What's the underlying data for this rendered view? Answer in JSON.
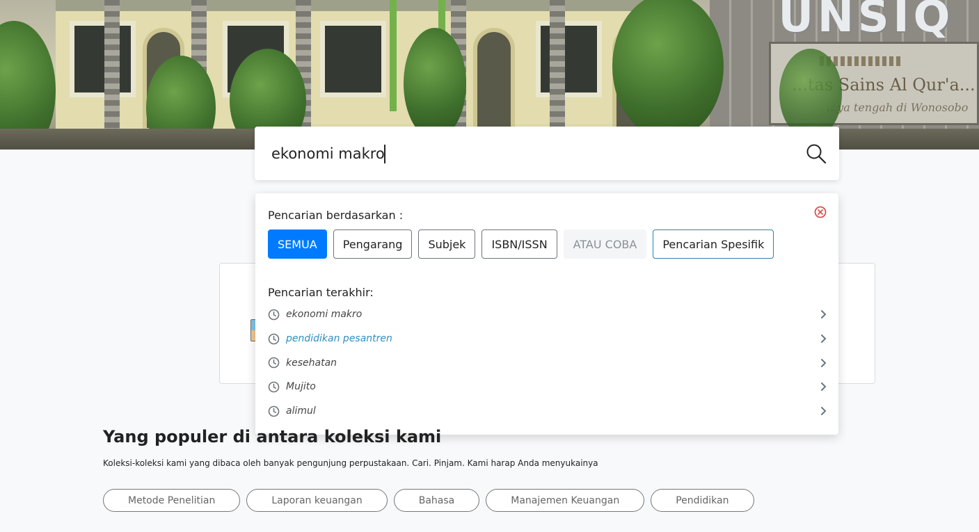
{
  "search": {
    "value": "ekonomi makro",
    "search_icon": "search-icon"
  },
  "dropdown": {
    "filter_label": "Pencarian berdasarkan :",
    "close_icon": "close-circle-icon",
    "filters": [
      {
        "label": "SEMUA",
        "state": "active"
      },
      {
        "label": "Pengarang",
        "state": "default"
      },
      {
        "label": "Subjek",
        "state": "default"
      },
      {
        "label": "ISBN/ISSN",
        "state": "default"
      },
      {
        "label": "ATAU COBA",
        "state": "muted"
      },
      {
        "label": "Pencarian Spesifik",
        "state": "outline-primary"
      }
    ],
    "recent_label": "Pencarian terakhir:",
    "recent": [
      {
        "text": "ekonomi makro",
        "highlight": false
      },
      {
        "text": "pendidikan pesantren",
        "highlight": true
      },
      {
        "text": "kesehatan",
        "highlight": false
      },
      {
        "text": "Mujito",
        "highlight": false
      },
      {
        "text": "alimul",
        "highlight": false
      }
    ]
  },
  "hero": {
    "sign_text": "UNSIQ",
    "plaque_text": "...tas Sains Al Qur'a...",
    "plaque_sub": "...ya tengah di Wonosobo"
  },
  "popular": {
    "title": "Yang populer di antara koleksi kami",
    "subtitle": "Koleksi-koleksi kami yang dibaca oleh banyak pengunjung perpustakaan. Cari. Pinjam. Kami harap Anda menyukainya",
    "tags": [
      "Metode Penelitian",
      "Laporan keuangan",
      "Bahasa",
      "Manajemen Keuangan",
      "Pendidikan"
    ]
  },
  "colors": {
    "primary": "#007bff",
    "close_red": "#d9534f",
    "link": "#2f8fc0"
  }
}
